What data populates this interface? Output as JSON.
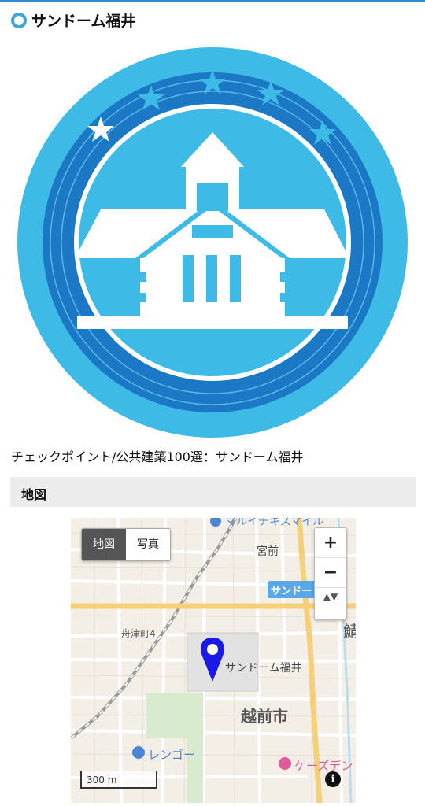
{
  "header": {
    "title": "サンドーム福井"
  },
  "badge": {
    "icon": "building-badge-icon",
    "colors": {
      "outer": "#3dbbe6",
      "ring": "#1a78c4",
      "inner": "#3dbbe6",
      "white": "#ffffff"
    }
  },
  "caption": "チェックポイント/公共建築100選：サンドーム福井",
  "section": {
    "title": "地図"
  },
  "map": {
    "type_buttons": {
      "map": "地図",
      "photo": "写真",
      "active": "map"
    },
    "zoom_in": "+",
    "zoom_out": "−",
    "compass": "▲▼",
    "scale": "300 m",
    "info": "i",
    "labels": {
      "top_store": "マルイチキスマイル",
      "miyamae": "宮前",
      "sundome_tag": "サンドー",
      "funatsu": "舟津町4",
      "marker_label": "サンドーム福井",
      "city": "越前市",
      "rengo": "レンゴー",
      "keiz": "ケーズデン",
      "edge_char": "鯖"
    },
    "colors": {
      "marker": "#1a1ae6",
      "main_road": "#f5cf7a",
      "river": "#b9dcf0",
      "rail": "#9a9a9a"
    }
  }
}
